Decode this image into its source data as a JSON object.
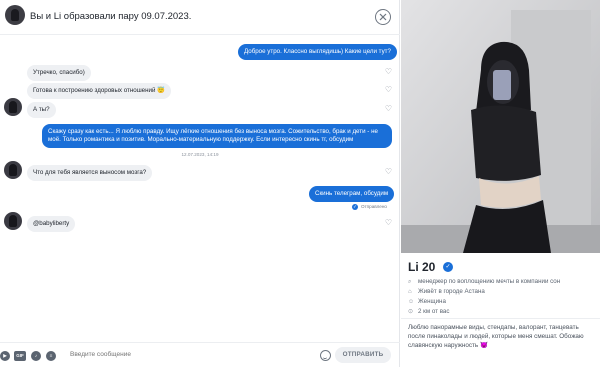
{
  "header": {
    "title": "Вы и Li образовали пару 09.07.2023."
  },
  "messages": [
    {
      "dir": "out",
      "text": "Доброе утро. Классно выглядишь) Какие цели тут?"
    },
    {
      "dir": "in",
      "text": "Утречко, спасибо)"
    },
    {
      "dir": "in",
      "text": "Готова к построению здоровых отношений 😇"
    },
    {
      "dir": "in",
      "text": "А ты?"
    },
    {
      "dir": "out",
      "text": "Скажу сразу как есть... Я люблю правду. Ищу лёгкие отношения без выноса мозга. Сожительство, брак и дети - не моё. Только романтика и позитив. Морально-материальную поддержку. Если интересно скинь тг, обсудим"
    },
    {
      "dir": "in",
      "text": "Что для тебя является выносом мозга?"
    },
    {
      "dir": "out",
      "text": "Скинь телеграм, обсудим"
    },
    {
      "dir": "in",
      "text": "@babyliberty"
    }
  ],
  "timestamp": "12.07.2023, 14:19",
  "sent_status": "Отправлено",
  "composer": {
    "placeholder": "Введите сообщение",
    "send_label": "ОТПРАВИТЬ",
    "gif_label": "GIF"
  },
  "profile": {
    "name": "Li 20",
    "details": [
      {
        "icon": "search-icon",
        "text": "менеджер по воплощению мечты в компании сон"
      },
      {
        "icon": "home-icon",
        "text": "Живёт в городе Астана"
      },
      {
        "icon": "person-icon",
        "text": "Женщина"
      },
      {
        "icon": "location-pin-icon",
        "text": "2 км от вас"
      }
    ],
    "bio": "Люблю панорамные виды, стендапы, валорант, танцевать после пинаколады и людей, которые меня смешат. Обожаю славянскую наружность 😈"
  },
  "colors": {
    "accent": "#1a6fd8",
    "incoming_bubble": "#eef0f3"
  }
}
